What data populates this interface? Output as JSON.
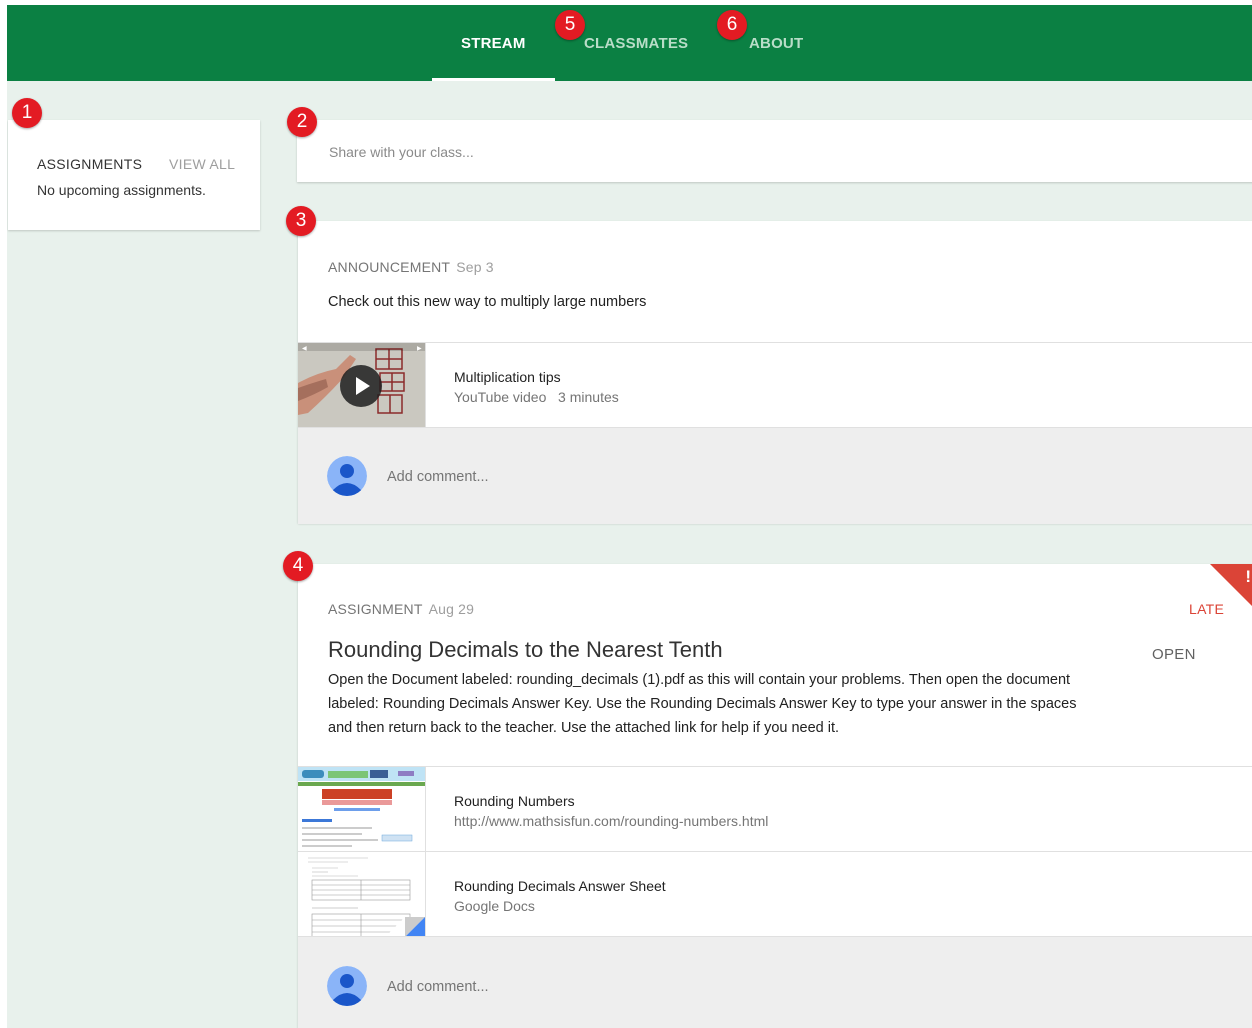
{
  "nav": {
    "tabs": [
      {
        "label": "STREAM",
        "active": true
      },
      {
        "label": "CLASSMATES",
        "active": false
      },
      {
        "label": "ABOUT",
        "active": false
      }
    ]
  },
  "markers": [
    "1",
    "2",
    "3",
    "4",
    "5",
    "6"
  ],
  "sidebar": {
    "heading": "ASSIGNMENTS",
    "view_all": "VIEW ALL",
    "empty_text": "No upcoming assignments."
  },
  "share": {
    "placeholder": "Share with your class..."
  },
  "announcement": {
    "type": "ANNOUNCEMENT",
    "date": "Sep 3",
    "body": "Check out this new way to multiply large numbers",
    "attachment": {
      "title": "Multiplication tips",
      "subtitle": "YouTube video   3 minutes",
      "icon": "play-icon"
    },
    "comment_placeholder": "Add comment..."
  },
  "assignment": {
    "type": "ASSIGNMENT",
    "date": "Aug 29",
    "status": "LATE",
    "status_icon": "!",
    "action": "OPEN",
    "title": "Rounding Decimals to the Nearest Tenth",
    "description": "Open the Document labeled: rounding_decimals (1).pdf as this will contain your problems. Then open the document labeled: Rounding Decimals Answer Key. Use the Rounding Decimals Answer Key to type your answer in the spaces and then return back to the teacher. Use the attached link for help if you need it.",
    "attachments": [
      {
        "title": "Rounding Numbers",
        "subtitle": "http://www.mathsisfun.com/rounding-numbers.html"
      },
      {
        "title": "Rounding Decimals Answer Sheet",
        "subtitle": "Google Docs"
      }
    ],
    "comment_placeholder": "Add comment..."
  },
  "colors": {
    "header": "#0b8043",
    "background": "#e8f1ec",
    "late": "#db4437",
    "marker": "#e31b23"
  }
}
